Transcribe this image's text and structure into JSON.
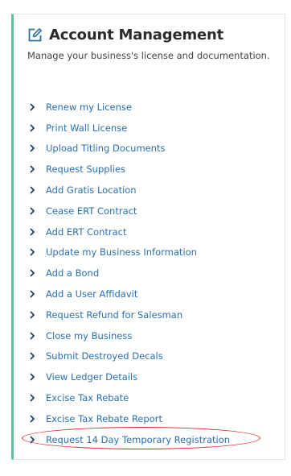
{
  "panel": {
    "title": "Account Management",
    "subtitle": "Manage your business's license and documentation.",
    "accent_color": "#5dc39a",
    "title_icon": "edit-icon"
  },
  "actions": [
    {
      "label": "Renew my License"
    },
    {
      "label": "Print Wall License"
    },
    {
      "label": "Upload Titling Documents"
    },
    {
      "label": "Request Supplies"
    },
    {
      "label": "Add Gratis Location"
    },
    {
      "label": "Cease ERT Contract"
    },
    {
      "label": "Add ERT Contract"
    },
    {
      "label": "Update my Business Information"
    },
    {
      "label": "Add a Bond"
    },
    {
      "label": "Add a User Affidavit"
    },
    {
      "label": "Request Refund for Salesman"
    },
    {
      "label": "Close my Business"
    },
    {
      "label": "Submit Destroyed Decals"
    },
    {
      "label": "View Ledger Details"
    },
    {
      "label": "Excise Tax Rebate"
    },
    {
      "label": "Excise Tax Rebate Report"
    },
    {
      "label": "Request 14 Day Temporary Registration"
    }
  ],
  "colors": {
    "link": "#2a6fb0",
    "highlight": "#d9262b"
  }
}
